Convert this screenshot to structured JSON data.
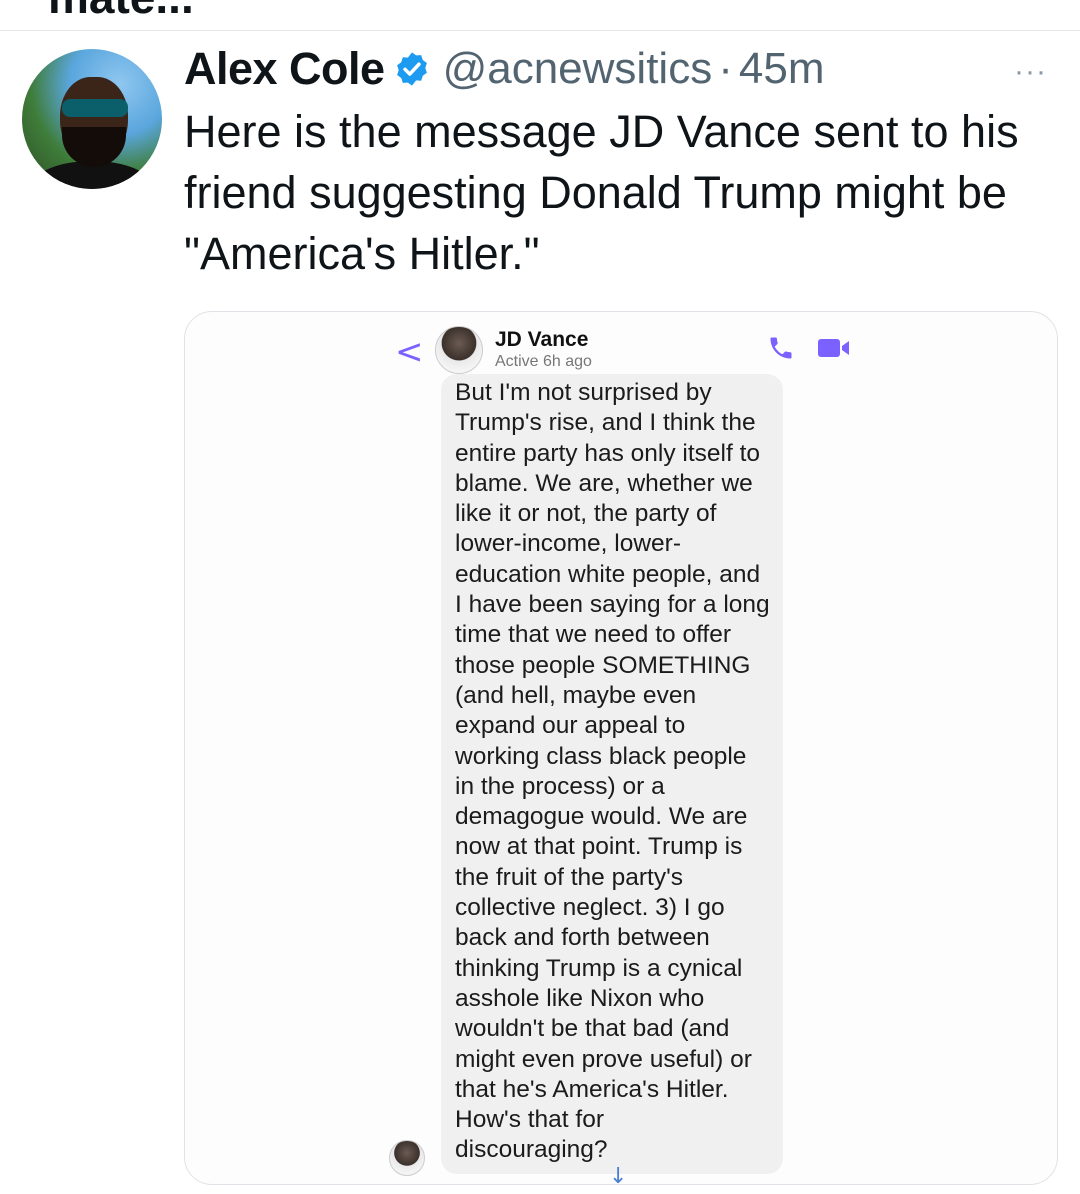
{
  "top_crop": {
    "text": "mate..."
  },
  "tweet": {
    "author_name": "Alex Cole",
    "handle": "@acnewsitics",
    "separator": "·",
    "time": "45m",
    "more": "···",
    "text": "Here is the message JD Vance sent to his friend suggesting Donald Trump might be \"America's Hitler.\""
  },
  "messenger": {
    "back": "<",
    "contact_name": "JD Vance",
    "status": "Active 6h ago",
    "message": "But I'm not surprised by\nTrump's rise, and I think the\nentire party has only itself to\nblame.  We are, whether we\nlike it or not, the party of\nlower-income, lower-\neducation white people, and\nI have been saying for a long\ntime that we need to offer\nthose people SOMETHING\n(and hell, maybe even\nexpand our appeal to\nworking class black people\nin the process) or a\ndemagogue would.  We are\nnow at that point.  Trump is\nthe fruit of the party's\ncollective neglect.  3) I go\nback and forth between\nthinking Trump is a cynical\nasshole like Nixon who\nwouldn't be that bad (and\nmight even prove useful) or\nthat he's America's Hitler.\nHow's that for\ndiscouraging?",
    "scroll_arrow": "↓"
  },
  "colors": {
    "accent": "#1d9bf0",
    "messenger_accent": "#7b61ff"
  }
}
